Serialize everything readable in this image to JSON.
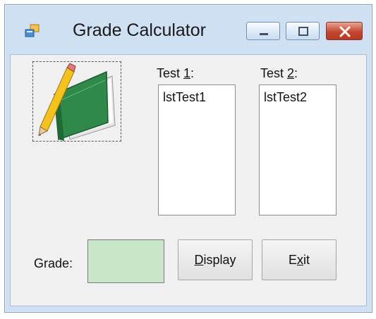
{
  "window": {
    "title": "Grade Calculator",
    "icons": {
      "app": "form-icon",
      "minimize": "minimize-icon",
      "maximize": "maximize-icon",
      "close": "close-icon",
      "picture": "book-and-pencil-icon"
    }
  },
  "labels": {
    "test1_prefix": "Test ",
    "test1_key": "1",
    "test1_suffix": ":",
    "test2_prefix": "Test ",
    "test2_key": "2",
    "test2_suffix": ":",
    "grade": "Grade:"
  },
  "lists": {
    "test1_item": "lstTest1",
    "test2_item": "lstTest2"
  },
  "grade_value": "",
  "buttons": {
    "display_key": "D",
    "display_rest": "isplay",
    "exit_first": "E",
    "exit_key": "x",
    "exit_rest": "it"
  },
  "colors": {
    "grade_background": "#c8e6c8",
    "close_button": "#c4462f"
  }
}
